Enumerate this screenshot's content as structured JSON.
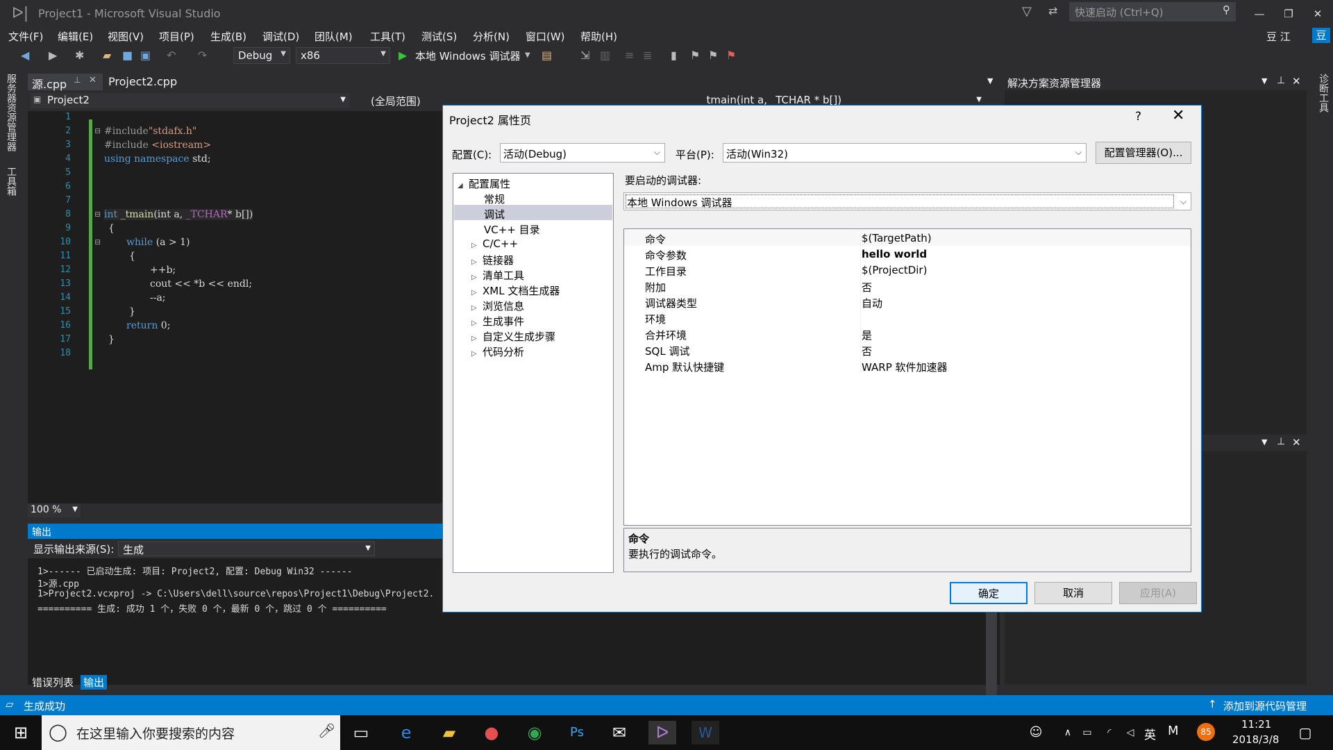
{
  "window": {
    "title": "Project1 - Microsoft Visual Studio",
    "quick_launch_placeholder": "快速启动 (Ctrl+Q)",
    "user": "豆 江",
    "user_badge": "豆"
  },
  "menu": [
    "文件(F)",
    "编辑(E)",
    "视图(V)",
    "项目(P)",
    "生成(B)",
    "调试(D)",
    "团队(M)",
    "工具(T)",
    "测试(S)",
    "分析(N)",
    "窗口(W)",
    "帮助(H)"
  ],
  "toolbar": {
    "config": "Debug",
    "platform": "x86",
    "debugger": "本地 Windows 调试器"
  },
  "left_strip": [
    "服务器资源管理器",
    "工具箱"
  ],
  "right_strip": [
    "诊断工具"
  ],
  "tabs": [
    "源.cpp",
    "Project2.cpp"
  ],
  "nav": {
    "project": "Project2",
    "scope": "(全局范围)",
    "member": "_tmain(int a, _TCHAR * b[])"
  },
  "code_lines": [
    "1",
    "2",
    "3",
    "4",
    "5",
    "6",
    "7",
    "8",
    "9",
    "10",
    "11",
    "12",
    "13",
    "14",
    "15",
    "16",
    "17",
    "18"
  ],
  "code": {
    "l2a": "#include",
    "l2b": "\"stdafx.h\"",
    "l3a": "#include ",
    "l3b": "<iostream>",
    "l4a": "using namespace",
    "l4b": " std;",
    "l8a": "int",
    "l8b": "_tmain",
    "l8c": "(int a, ",
    "l8d": "_TCHAR",
    "l8e": "* b[])",
    "l9": "{",
    "l10a": "while",
    "l10b": " (a > 1)",
    "l11": "{",
    "l12": "++b;",
    "l13": "cout << *b << endl;",
    "l14": "--a;",
    "l15": "}",
    "l16a": "return",
    "l16b": " 0;",
    "l17": "}"
  },
  "zoom": "100 %",
  "output": {
    "header": "输出",
    "source_label": "显示输出来源(S):",
    "source_value": "生成",
    "lines": [
      "1>------ 已启动生成: 项目: Project2, 配置: Debug Win32 ------",
      "1>源.cpp",
      "1>Project2.vcxproj -> C:\\Users\\dell\\source\\repos\\Project1\\Debug\\Project2.",
      "========== 生成: 成功 1 个，失败 0 个，最新 0 个，跳过 0 个 =========="
    ]
  },
  "bottom_tabs": [
    "错误列表",
    "输出"
  ],
  "solution_explorer": {
    "title": "解决方案资源管理器"
  },
  "status": {
    "left": "生成成功",
    "right": "添加到源代码管理"
  },
  "dialog": {
    "title": "Project2 属性页",
    "help": "?",
    "config_label": "配置(C):",
    "config_value": "活动(Debug)",
    "platform_label": "平台(P):",
    "platform_value": "活动(Win32)",
    "config_manager": "配置管理器(O)...",
    "debugger_label": "要启动的调试器:",
    "debugger_value": "本地 Windows 调试器",
    "tree": [
      {
        "label": "配置属性",
        "expander": "◢"
      },
      {
        "label": "常规",
        "expander": ""
      },
      {
        "label": "调试",
        "expander": ""
      },
      {
        "label": "VC++ 目录",
        "expander": ""
      },
      {
        "label": "C/C++",
        "expander": "▷"
      },
      {
        "label": "链接器",
        "expander": "▷"
      },
      {
        "label": "清单工具",
        "expander": "▷"
      },
      {
        "label": "XML 文档生成器",
        "expander": "▷"
      },
      {
        "label": "浏览信息",
        "expander": "▷"
      },
      {
        "label": "生成事件",
        "expander": "▷"
      },
      {
        "label": "自定义生成步骤",
        "expander": "▷"
      },
      {
        "label": "代码分析",
        "expander": "▷"
      }
    ],
    "properties": [
      {
        "name": "命令",
        "value": "$(TargetPath)"
      },
      {
        "name": "命令参数",
        "value": "hello world"
      },
      {
        "name": "工作目录",
        "value": "$(ProjectDir)"
      },
      {
        "name": "附加",
        "value": "否"
      },
      {
        "name": "调试器类型",
        "value": "自动"
      },
      {
        "name": "环境",
        "value": ""
      },
      {
        "name": "合并环境",
        "value": "是"
      },
      {
        "name": "SQL 调试",
        "value": "否"
      },
      {
        "name": "Amp 默认快捷键",
        "value": "WARP 软件加速器"
      }
    ],
    "desc_title": "命令",
    "desc_text": "要执行的调试命令。",
    "ok": "确定",
    "cancel": "取消",
    "apply": "应用(A)"
  },
  "taskbar": {
    "search": "在这里输入你要搜索的内容",
    "time": "11:21",
    "date": "2018/3/8",
    "ime": "英",
    "badge": "85"
  }
}
